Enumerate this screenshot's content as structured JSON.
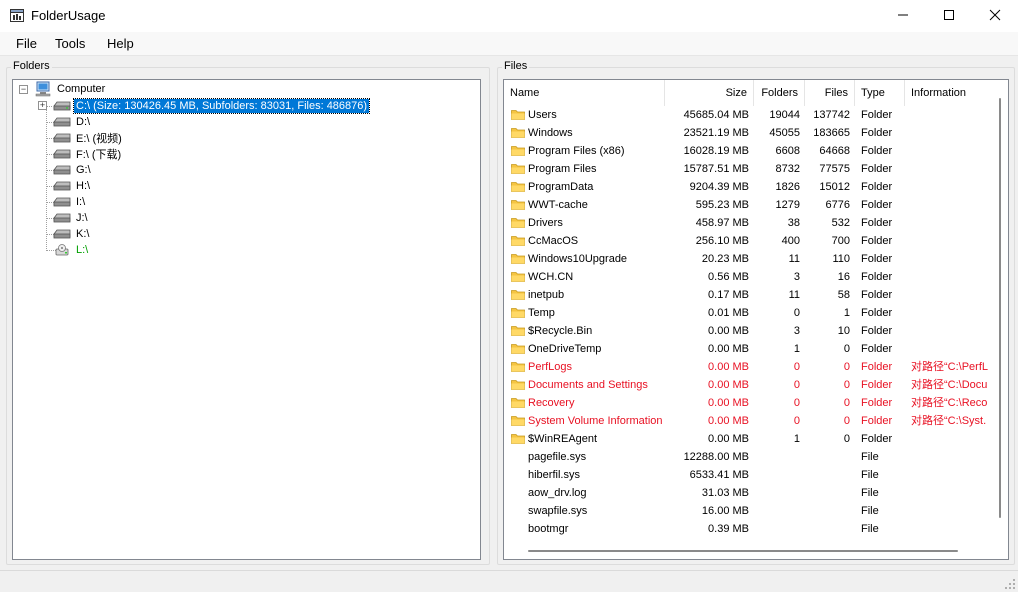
{
  "window": {
    "title": "FolderUsage",
    "app_icon": "app-icon",
    "controls": [
      "minimize-icon",
      "maximize-icon",
      "close-icon"
    ]
  },
  "menu": [
    "File",
    "Tools",
    "Help"
  ],
  "folders_panel": {
    "label": "Folders",
    "root": "Computer",
    "drives": [
      {
        "label": "C:\\ (Size: 130426.45 MB, Subfolders: 83031, Files: 486876)",
        "selected": true
      },
      {
        "label": "D:\\"
      },
      {
        "label": "E:\\ (视频)"
      },
      {
        "label": "F:\\ (下载)"
      },
      {
        "label": "G:\\"
      },
      {
        "label": "H:\\"
      },
      {
        "label": "I:\\"
      },
      {
        "label": "J:\\"
      },
      {
        "label": "K:\\"
      },
      {
        "label": "L:\\",
        "color": "#00a000",
        "icon": "removable-drive-icon"
      }
    ]
  },
  "files_panel": {
    "label": "Files",
    "columns": [
      "Name",
      "Size",
      "Folders",
      "Files",
      "Type",
      "Information"
    ],
    "rows": [
      {
        "name": "Users",
        "size": "45685.04 MB",
        "folders": "19044",
        "files": "137742",
        "type": "Folder",
        "info": ""
      },
      {
        "name": "Windows",
        "size": "23521.19 MB",
        "folders": "45055",
        "files": "183665",
        "type": "Folder",
        "info": ""
      },
      {
        "name": "Program Files (x86)",
        "size": "16028.19 MB",
        "folders": "6608",
        "files": "64668",
        "type": "Folder",
        "info": ""
      },
      {
        "name": "Program Files",
        "size": "15787.51 MB",
        "folders": "8732",
        "files": "77575",
        "type": "Folder",
        "info": ""
      },
      {
        "name": "ProgramData",
        "size": "9204.39 MB",
        "folders": "1826",
        "files": "15012",
        "type": "Folder",
        "info": ""
      },
      {
        "name": "WWT-cache",
        "size": "595.23 MB",
        "folders": "1279",
        "files": "6776",
        "type": "Folder",
        "info": ""
      },
      {
        "name": "Drivers",
        "size": "458.97 MB",
        "folders": "38",
        "files": "532",
        "type": "Folder",
        "info": ""
      },
      {
        "name": "CcMacOS",
        "size": "256.10 MB",
        "folders": "400",
        "files": "700",
        "type": "Folder",
        "info": ""
      },
      {
        "name": "Windows10Upgrade",
        "size": "20.23 MB",
        "folders": "11",
        "files": "110",
        "type": "Folder",
        "info": ""
      },
      {
        "name": "WCH.CN",
        "size": "0.56 MB",
        "folders": "3",
        "files": "16",
        "type": "Folder",
        "info": ""
      },
      {
        "name": "inetpub",
        "size": "0.17 MB",
        "folders": "11",
        "files": "58",
        "type": "Folder",
        "info": ""
      },
      {
        "name": "Temp",
        "size": "0.01 MB",
        "folders": "0",
        "files": "1",
        "type": "Folder",
        "info": ""
      },
      {
        "name": "$Recycle.Bin",
        "size": "0.00 MB",
        "folders": "3",
        "files": "10",
        "type": "Folder",
        "info": ""
      },
      {
        "name": "OneDriveTemp",
        "size": "0.00 MB",
        "folders": "1",
        "files": "0",
        "type": "Folder",
        "info": ""
      },
      {
        "name": "PerfLogs",
        "size": "0.00 MB",
        "folders": "0",
        "files": "0",
        "type": "Folder",
        "info": "对路径“C:\\PerfL",
        "warn": true
      },
      {
        "name": "Documents and Settings",
        "size": "0.00 MB",
        "folders": "0",
        "files": "0",
        "type": "Folder",
        "info": "对路径“C:\\Docu",
        "warn": true
      },
      {
        "name": "Recovery",
        "size": "0.00 MB",
        "folders": "0",
        "files": "0",
        "type": "Folder",
        "info": "对路径“C:\\Reco",
        "warn": true
      },
      {
        "name": "System Volume Information",
        "size": "0.00 MB",
        "folders": "0",
        "files": "0",
        "type": "Folder",
        "info": "对路径“C:\\Syst.",
        "warn": true
      },
      {
        "name": "$WinREAgent",
        "size": "0.00 MB",
        "folders": "1",
        "files": "0",
        "type": "Folder",
        "info": ""
      },
      {
        "name": "pagefile.sys",
        "size": "12288.00 MB",
        "folders": "",
        "files": "",
        "type": "File",
        "info": ""
      },
      {
        "name": "hiberfil.sys",
        "size": "6533.41 MB",
        "folders": "",
        "files": "",
        "type": "File",
        "info": ""
      },
      {
        "name": "aow_drv.log",
        "size": "31.03 MB",
        "folders": "",
        "files": "",
        "type": "File",
        "info": ""
      },
      {
        "name": "swapfile.sys",
        "size": "16.00 MB",
        "folders": "",
        "files": "",
        "type": "File",
        "info": ""
      },
      {
        "name": "bootmgr",
        "size": "0.39 MB",
        "folders": "",
        "files": "",
        "type": "File",
        "info": ""
      }
    ]
  },
  "colors": {
    "selection": "#0078d7",
    "warning": "#e81123",
    "removable": "#00a000",
    "folder": "#f5c542"
  }
}
